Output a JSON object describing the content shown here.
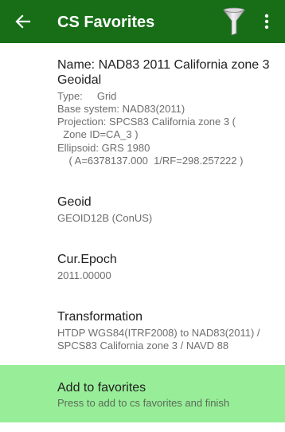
{
  "appbar": {
    "title": "CS Favorites",
    "back_icon": "arrow-left-icon",
    "filter_icon": "funnel-filter-icon",
    "menu_icon": "more-vertical-icon",
    "background": "#176e17"
  },
  "cs": {
    "name_line1": "Name: NAD83 2011 California zone 3",
    "name_line2": "Geoidal",
    "type": "Type:     Grid",
    "base_system": "Base system: NAD83(2011)",
    "projection_line1": "Projection: SPCS83 California zone 3 (",
    "projection_line2": "  Zone ID=CA_3 )",
    "ellipsoid_line1": "Ellipsoid: GRS 1980",
    "ellipsoid_line2": "    ( A=6378137.000  1/RF=298.257222 )"
  },
  "geoid": {
    "label": "Geoid",
    "value": "GEOID12B (ConUS)"
  },
  "epoch": {
    "label": "Cur.Epoch",
    "value": "2011.00000"
  },
  "transformation": {
    "label": "Transformation",
    "value_line1": "HTDP WGS84(ITRF2008) to NAD83(2011) /",
    "value_line2": "SPCS83 California zone 3 / NAVD 88"
  },
  "add_favorites": {
    "label": "Add to favorites",
    "description": "Press to add to cs favorites and finish",
    "background": "#98ee98"
  }
}
